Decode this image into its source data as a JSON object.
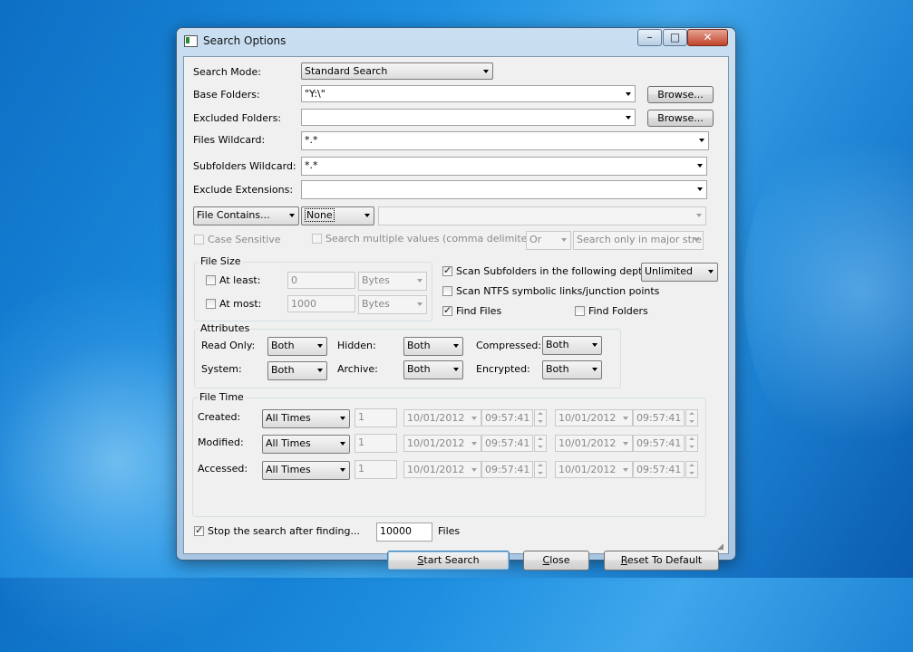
{
  "window": {
    "title": "Search Options",
    "minimize_glyph": "–",
    "maximize_glyph": "□",
    "close_glyph": "✕"
  },
  "search_mode": {
    "label": "Search Mode:",
    "value": "Standard Search"
  },
  "base_folders": {
    "label": "Base Folders:",
    "value": "\"Y:\\\"",
    "browse": "Browse..."
  },
  "excluded_folders": {
    "label": "Excluded Folders:",
    "value": "",
    "browse": "Browse..."
  },
  "files_wildcard": {
    "label": "Files Wildcard:",
    "value": "*.*"
  },
  "subfolders_wildcard": {
    "label": "Subfolders Wildcard:",
    "value": "*.*"
  },
  "exclude_extensions": {
    "label": "Exclude Extensions:",
    "value": ""
  },
  "contains": {
    "mode": "File Contains...",
    "type": "None",
    "text": ""
  },
  "case_sensitive": {
    "label": "Case Sensitive",
    "checked": false
  },
  "multi_values": {
    "label": "Search multiple values (comma delimited)",
    "checked": false,
    "logic": "Or",
    "scope": "Search only in major stre"
  },
  "file_size": {
    "title": "File Size",
    "at_least": {
      "label": "At least:",
      "value": "0",
      "unit": "Bytes",
      "checked": false
    },
    "at_most": {
      "label": "At most:",
      "value": "1000",
      "unit": "Bytes",
      "checked": false
    }
  },
  "scan_subfolders": {
    "label": "Scan Subfolders in the following depth:",
    "checked": true,
    "depth": "Unlimited"
  },
  "scan_ntfs": {
    "label": "Scan NTFS symbolic links/junction points",
    "checked": false
  },
  "find_files": {
    "label": "Find Files",
    "checked": true
  },
  "find_folders": {
    "label": "Find Folders",
    "checked": false
  },
  "attributes": {
    "title": "Attributes",
    "read_only": {
      "label": "Read Only:",
      "value": "Both"
    },
    "hidden": {
      "label": "Hidden:",
      "value": "Both"
    },
    "compressed": {
      "label": "Compressed:",
      "value": "Both"
    },
    "system": {
      "label": "System:",
      "value": "Both"
    },
    "archive": {
      "label": "Archive:",
      "value": "Both"
    },
    "encrypted": {
      "label": "Encrypted:",
      "value": "Both"
    }
  },
  "file_time": {
    "title": "File Time",
    "rows": [
      {
        "label": "Created:",
        "mode": "All Times",
        "count": "1",
        "date1": "10/01/2012",
        "time1": "09:57:41",
        "date2": "10/01/2012",
        "time2": "09:57:41"
      },
      {
        "label": "Modified:",
        "mode": "All Times",
        "count": "1",
        "date1": "10/01/2012",
        "time1": "09:57:41",
        "date2": "10/01/2012",
        "time2": "09:57:41"
      },
      {
        "label": "Accessed:",
        "mode": "All Times",
        "count": "1",
        "date1": "10/01/2012",
        "time1": "09:57:41",
        "date2": "10/01/2012",
        "time2": "09:57:41"
      }
    ]
  },
  "stop_after": {
    "label": "Stop the search after finding...",
    "checked": true,
    "value": "10000",
    "unit": "Files"
  },
  "buttons": {
    "start_u": "S",
    "start_rest": "tart Search",
    "close_u": "C",
    "close_rest": "lose",
    "reset_u": "R",
    "reset_rest": "eset To Default"
  }
}
